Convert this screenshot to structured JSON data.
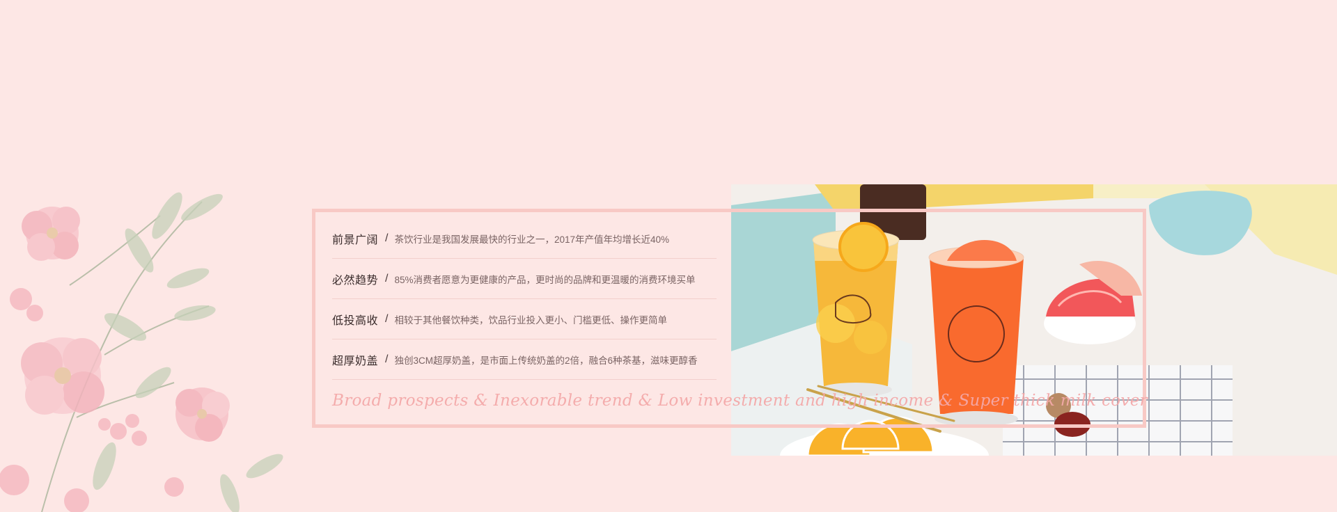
{
  "features": [
    {
      "title": "前景广阔",
      "separator": "/",
      "description": "茶饮行业是我国发展最快的行业之一，2017年产值年均增长近40%"
    },
    {
      "title": "必然趋势",
      "separator": "/",
      "description": "85%消费者愿意为更健康的产品，更时尚的品牌和更温暖的消费环境买单"
    },
    {
      "title": "低投高收",
      "separator": "/",
      "description": "相较于其他餐饮种类，饮品行业投入更小、门槛更低、操作更简单"
    },
    {
      "title": "超厚奶盖",
      "separator": "/",
      "description": "独创3CM超厚奶盖，是市面上传统奶盖的2倍，融合6种茶基，滋味更醇香"
    }
  ],
  "tagline": "Broad prospects & Inexorable trend & Low investment and high income & Super thick milk cover",
  "colors": {
    "background": "#fde7e5",
    "frame": "#f8c9c5",
    "tagline": "#f4a9a9",
    "title_text": "#3a2c2c",
    "desc_text": "#7a6464"
  }
}
